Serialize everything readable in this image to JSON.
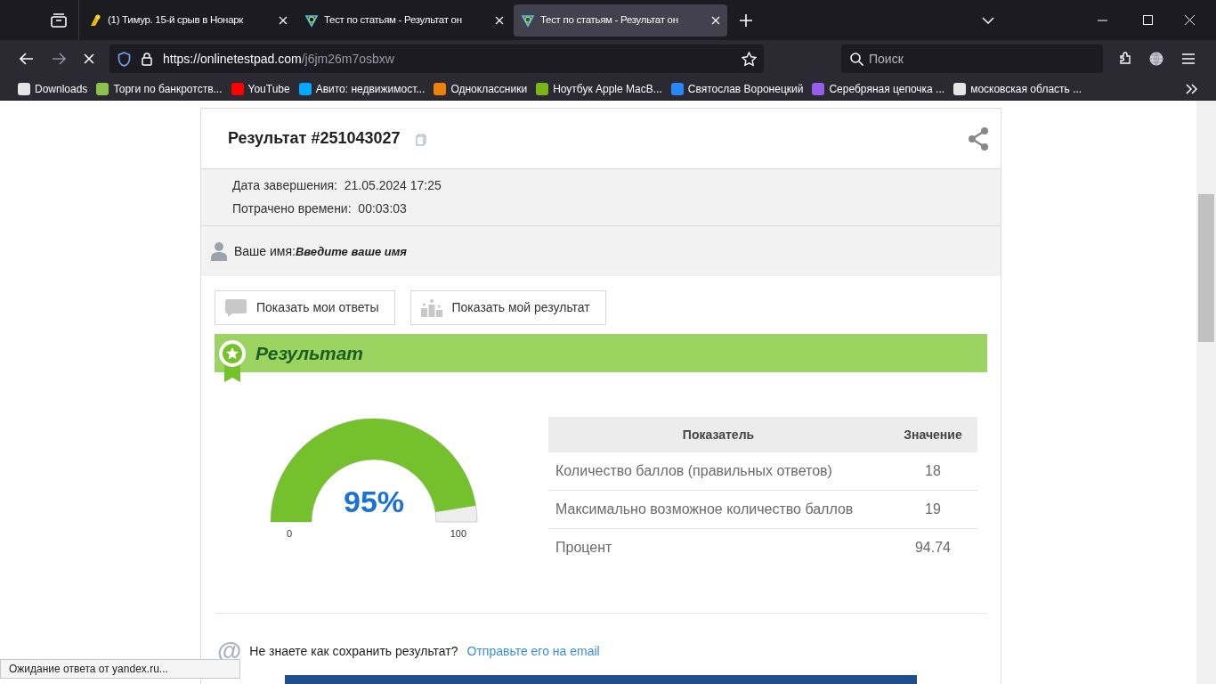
{
  "tabs": [
    {
      "title": "(1) Тимур. 15-й срыв в Нонарк",
      "selected": false
    },
    {
      "title": "Тест по статьям - Результат он",
      "selected": false
    },
    {
      "title": "Тест по статьям - Результат он",
      "selected": true
    }
  ],
  "address_bar": {
    "url_host": "https://onlinetestpad.com",
    "url_path": "/j6jm26m7osbxw"
  },
  "search": {
    "placeholder": "Поиск"
  },
  "bookmarks": [
    {
      "label": "Downloads",
      "color": "#e5e5e5"
    },
    {
      "label": "Торги по банкротств...",
      "color": "#8bc34a"
    },
    {
      "label": "YouTube",
      "color": "#ff0000"
    },
    {
      "label": "Авито: недвижимост...",
      "color": "#00aaff"
    },
    {
      "label": "Одноклассники",
      "color": "#ee8208"
    },
    {
      "label": "Ноутбук Apple MacB...",
      "color": "#7cb518"
    },
    {
      "label": "Святослав Воронецкий",
      "color": "#2787f5"
    },
    {
      "label": "Серебряная цепочка ...",
      "color": "#965eeb"
    },
    {
      "label": "московская область ...",
      "color": "#e5e5e5"
    }
  ],
  "result": {
    "title": "Результат #251043027",
    "meta": [
      {
        "label": "Дата завершения:",
        "value": "21.05.2024 17:25"
      },
      {
        "label": "Потрачено времени:",
        "value": "00:03:03"
      }
    ],
    "name_label": "Ваше имя:",
    "name_placeholder": "Введите ваше имя",
    "buttons": [
      {
        "label": "Показать мои ответы",
        "kind": "answers"
      },
      {
        "label": "Показать мой результат",
        "kind": "result"
      }
    ],
    "section_title": "Результат",
    "gauge": {
      "level": 0.95,
      "reading": "95%",
      "min": "0",
      "max": "100"
    },
    "table": {
      "columns": [
        "Показатель",
        "Значение"
      ],
      "rows": [
        [
          "Количество баллов (правильных ответов)",
          "18"
        ],
        [
          "Максимально возможное количество баллов",
          "19"
        ],
        [
          "Процент",
          "94.74"
        ]
      ]
    },
    "save_icon": "@",
    "save_question": "Не знаете как сохранить результат?",
    "save_link": "Отправьте его на email"
  },
  "status_bar": "Ожидание ответа от yandex.ru..."
}
